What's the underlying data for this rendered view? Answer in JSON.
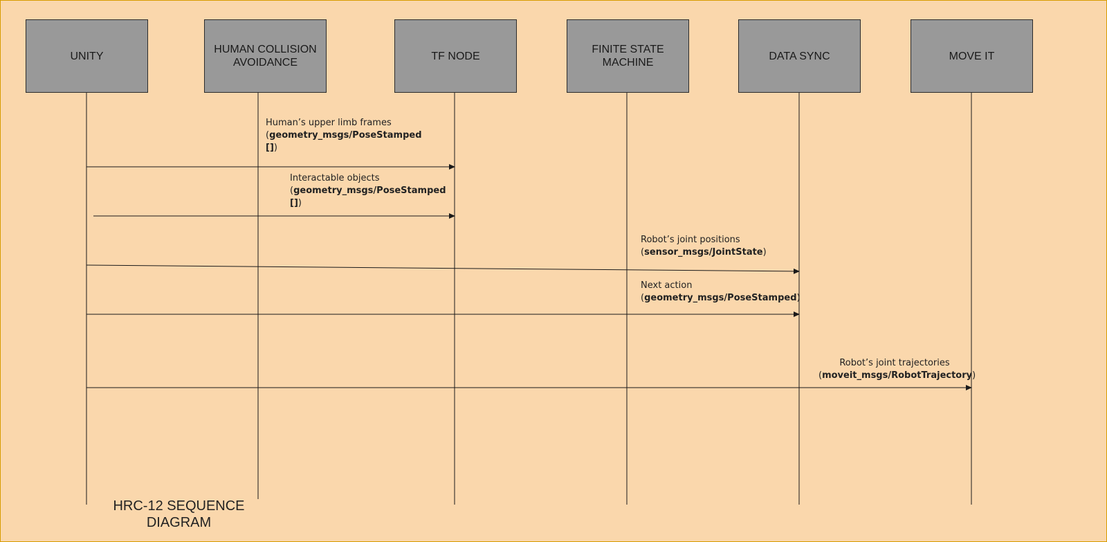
{
  "diagram": {
    "title": "HRC-12 SEQUENCE DIAGRAM",
    "participants": [
      {
        "id": "unity",
        "label": "UNITY"
      },
      {
        "id": "hca",
        "label": "HUMAN COLLISION AVOIDANCE"
      },
      {
        "id": "tf",
        "label": "TF NODE"
      },
      {
        "id": "fsm",
        "label": "FINITE STATE MACHINE"
      },
      {
        "id": "sync",
        "label": "DATA SYNC"
      },
      {
        "id": "moveit",
        "label": "MOVE IT"
      }
    ],
    "messages": [
      {
        "from": "unity",
        "to": "tf",
        "label": "Human’s upper limb frames",
        "type_name": "geometry_msgs/PoseStamped",
        "type_suffix": "[]",
        "open": "(",
        "close": ")"
      },
      {
        "from": "unity",
        "to": "tf",
        "label": "Interactable objects",
        "type_name": "geometry_msgs/PoseStamped",
        "type_suffix": "[]",
        "open": "(",
        "close": ")"
      },
      {
        "from": "unity",
        "to": "sync",
        "label": "Robot’s joint positions",
        "type_name": "sensor_msgs/JointState",
        "type_suffix": "",
        "open": "(",
        "close": ")"
      },
      {
        "from": "unity",
        "to": "sync",
        "label": "Next action",
        "type_name": "geometry_msgs/PoseStamped",
        "type_suffix": "",
        "open": "(",
        "close": ")"
      },
      {
        "from": "unity",
        "to": "moveit",
        "label": "Robot’s joint trajectories",
        "type_name": "moveit_msgs/RobotTrajectory",
        "type_suffix": "",
        "open": "(",
        "close": ")"
      }
    ]
  },
  "colors": {
    "background": "#fad7ac",
    "border": "#d79b00",
    "actor_fill": "#999999",
    "line": "#1a1a1a"
  }
}
